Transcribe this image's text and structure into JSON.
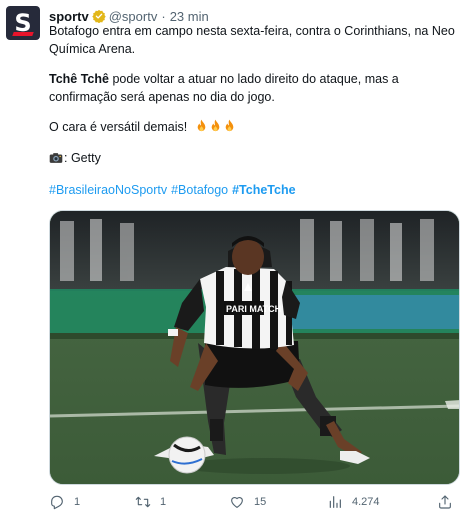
{
  "account": {
    "display_name": "sportv",
    "handle": "@sportv",
    "separator": "·",
    "time": "23 min",
    "avatar_letter": "S",
    "avatar_bg": "#262a3a",
    "avatar_accent": "#e8142b",
    "verified_icon": "gold-check-badge",
    "verified_color": "#e2b719"
  },
  "tweet": {
    "line1": "Botafogo entra em campo nesta sexta-feira, contra o Corinthians, na Neo Química Arena.",
    "line2_bold": "Tchê Tchê",
    "line2_rest": " pode voltar a atuar no lado direito do ataque, mas a confirmação será apenas no dia do jogo.",
    "line3": "O cara é versátil demais!",
    "line3_emoji": "fire-emoji",
    "credit_icon": "camera-emoji",
    "credit": ": Getty",
    "hashtags": [
      "#BrasileiraoNoSportv",
      "#Botafogo",
      "#TcheTche"
    ],
    "hashtag_color": "#1d9bf0"
  },
  "media": {
    "subject": "Botafogo player in black and white striped shirt dribbling a ball on a green pitch",
    "shirt_text": "PARI MATCH"
  },
  "actions": {
    "reply_count": "1",
    "retweet_count": "1",
    "like_count": "15",
    "views_count": "4.274",
    "icon_color": "#536471"
  }
}
